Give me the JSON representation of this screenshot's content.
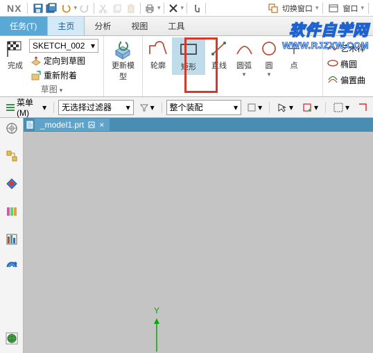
{
  "app": {
    "name": "NX"
  },
  "titlebar": {
    "switch_window": "切换窗口",
    "window": "窗口"
  },
  "menu": {
    "task": "任务(T)",
    "home": "主页",
    "analysis": "分析",
    "view": "视图",
    "tools": "工具"
  },
  "ribbon": {
    "sketch_group": {
      "finish": "完成",
      "sketch_name": "SKETCH_002",
      "orient_to_sketch": "定向到草图",
      "reattach": "重新附着",
      "group_label": "草图"
    },
    "update_model": "更新模型",
    "draw": {
      "profile": "轮廓",
      "rectangle": "矩形",
      "line": "直线",
      "arc": "圆弧",
      "circle": "圆",
      "point": "点"
    },
    "right": {
      "art_spline": "艺术样",
      "ellipse": "椭圆",
      "offset_curve": "偏置曲"
    }
  },
  "toolbar2": {
    "menu": "菜单(M)",
    "filter": "无选择过滤器",
    "assembly": "整个装配"
  },
  "document": {
    "tab": "_model1.prt"
  },
  "axis": {
    "y": "Y"
  },
  "watermark": {
    "line1": "软件自学网",
    "line2": "WWW.RJZXW.COM"
  }
}
